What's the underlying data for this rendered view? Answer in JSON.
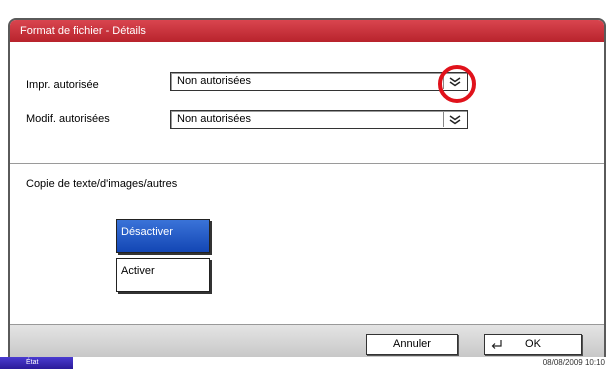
{
  "dialog": {
    "title": "Format de fichier - Détails"
  },
  "fields": [
    {
      "label": "Impr. autorisée",
      "value": "Non autorisées"
    },
    {
      "label": "Modif. autorisées",
      "value": "Non autorisées"
    }
  ],
  "copy_section": {
    "label": "Copie de texte/d'images/autres",
    "options": [
      {
        "label": "Désactiver",
        "selected": true
      },
      {
        "label": "Activer",
        "selected": false
      }
    ]
  },
  "footer": {
    "cancel_label": "Annuler",
    "ok_label": "OK"
  },
  "statusbar": {
    "tab_label": "État",
    "datetime": "08/08/2009   10:10"
  },
  "colors": {
    "title_bar": "#c22d36",
    "selected_button": "#1f55c4",
    "highlight_ring": "#e0121b",
    "status_tab": "#3a2bb8"
  }
}
